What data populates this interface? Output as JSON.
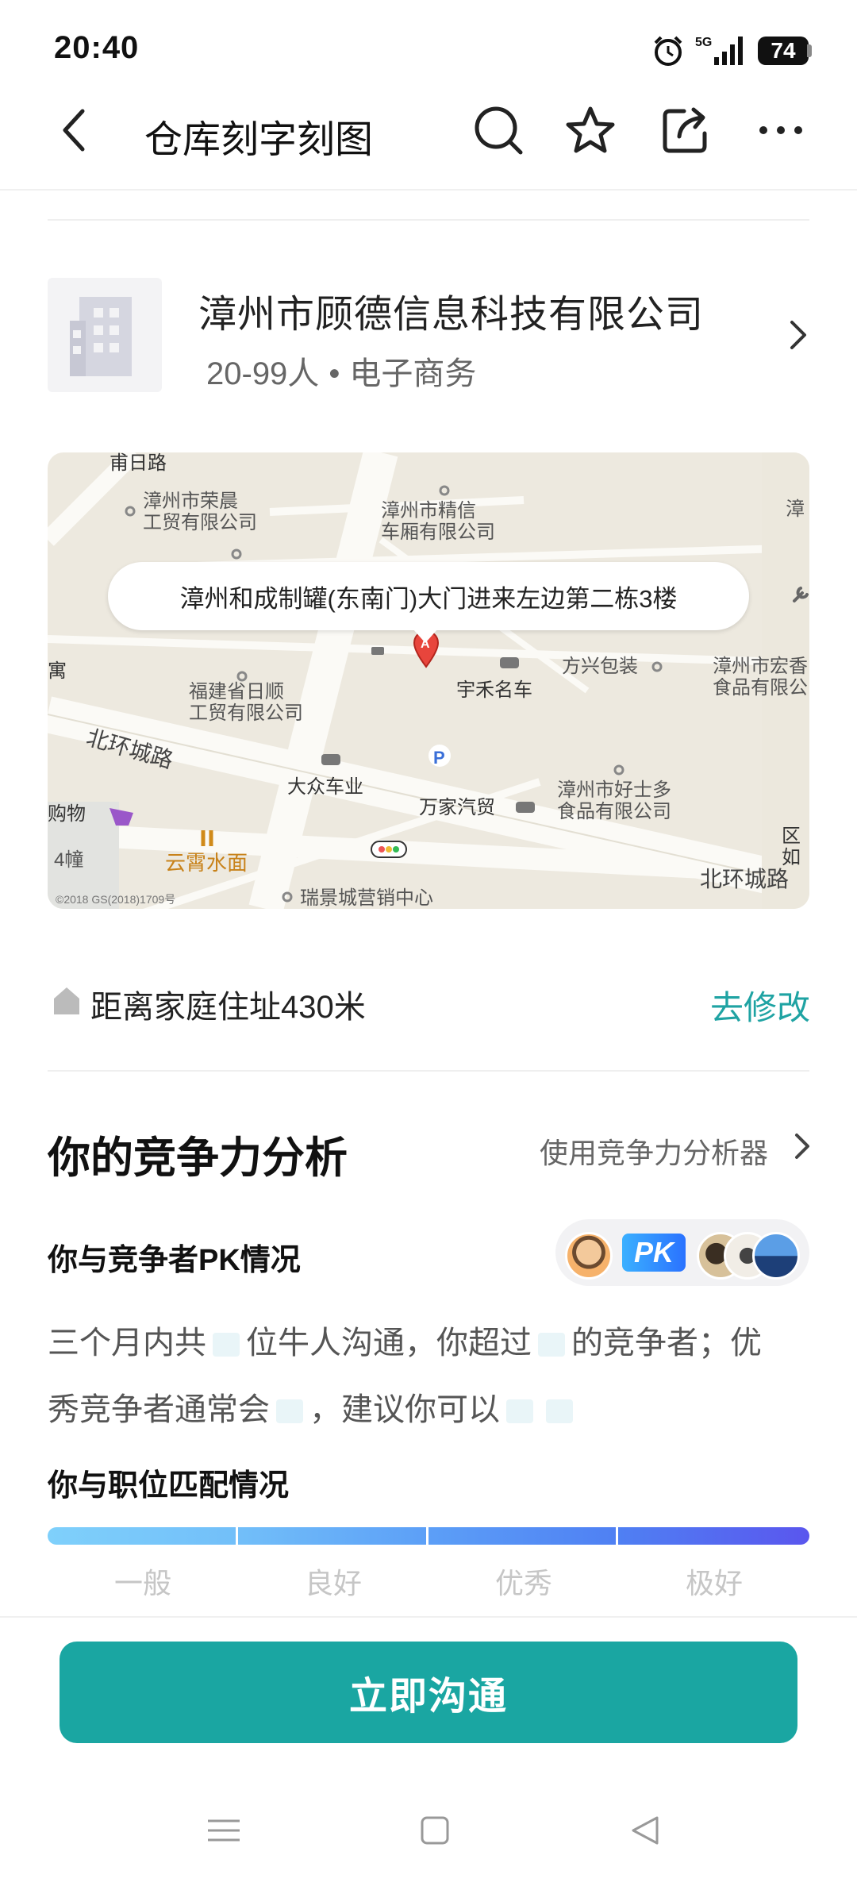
{
  "status_bar": {
    "time": "20:40",
    "battery": "74",
    "network": "5G"
  },
  "nav": {
    "title": "仓库刻字刻图"
  },
  "company": {
    "name": "漳州市顾德信息科技有限公司",
    "size": "20-99人",
    "industry": "电子商务"
  },
  "map": {
    "address": "漳州和成制罐(东南门)大门进来左边第二栋3楼",
    "marker_letter": "A",
    "labels": [
      "漳州市荣晨\n工贸有限公司",
      "漳州市精信\n车厢有限公司",
      "福建省日顺\n工贸有限公司",
      "宇禾名车",
      "方兴包装",
      "漳州市宏香\n食品有限公",
      "大众车业",
      "万家汽贸",
      "漳州市好士多\n食品有限公司",
      "云霄水面",
      "瑞景城营销中心",
      "购物",
      "4幢",
      "甫日路",
      "漳",
      "寓",
      "区如"
    ],
    "roads": [
      "北环城路",
      "北环城路"
    ],
    "copyright": "©2018 GS(2018)1709号"
  },
  "distance": {
    "text": "距离家庭住址430米",
    "action": "去修改"
  },
  "competition": {
    "title": "你的竞争力分析",
    "analyzer_link": "使用竞争力分析器",
    "pk_title": "你与竞争者PK情况",
    "pk_badge": "PK",
    "desc_1": "三个月内共",
    "desc_2": "位牛人沟通，你超过",
    "desc_3": "的竞争者；优",
    "desc_4": "秀竞争者通常会",
    "desc_5": "，建议你可以",
    "match_title": "你与职位匹配情况",
    "match_levels": [
      "一般",
      "良好",
      "优秀",
      "极好"
    ]
  },
  "actions": {
    "chat_button": "立即沟通"
  },
  "colors": {
    "accent": "#1aa6a2",
    "link": "#1fa3a3"
  }
}
